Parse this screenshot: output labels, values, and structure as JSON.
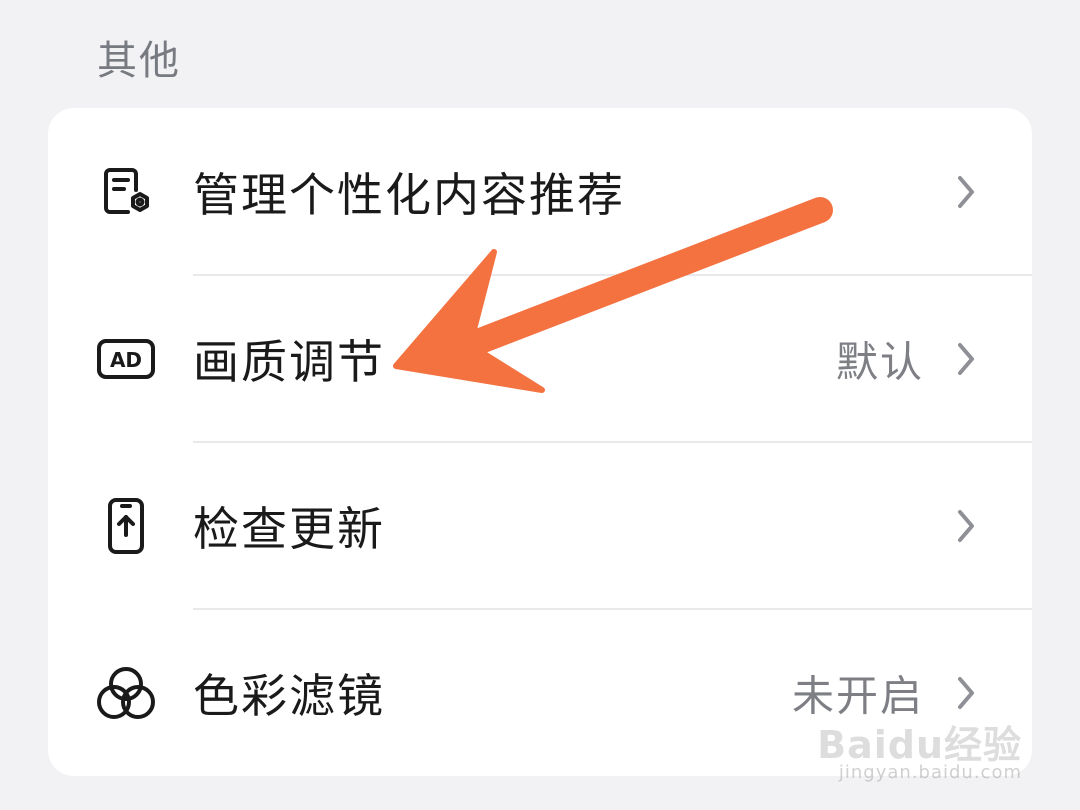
{
  "section": {
    "title": "其他"
  },
  "rows": [
    {
      "icon": "document-settings-icon",
      "label": "管理个性化内容推荐",
      "value": ""
    },
    {
      "icon": "ad-icon",
      "label": "画质调节",
      "value": "默认"
    },
    {
      "icon": "phone-upload-icon",
      "label": "检查更新",
      "value": ""
    },
    {
      "icon": "color-circles-icon",
      "label": "色彩滤镜",
      "value": "未开启"
    }
  ],
  "ad_icon_text": "AD",
  "annotation": {
    "color": "#f47140",
    "target": "画质调节"
  },
  "watermark": {
    "logo": "Baidu经验",
    "url": "jingyan.baidu.com"
  },
  "colors": {
    "background": "#f2f2f4",
    "card": "#ffffff",
    "label": "#1a1a1a",
    "secondary": "#7d7f85",
    "divider": "#e9e9eb",
    "chevron": "#8e9096"
  }
}
